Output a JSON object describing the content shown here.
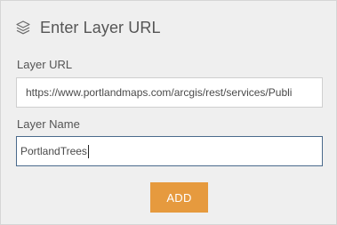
{
  "header": {
    "icon": "layers-icon",
    "title": "Enter Layer URL"
  },
  "url_field": {
    "label": "Layer URL",
    "value": "https://www.portlandmaps.com/arcgis/rest/services/Publi"
  },
  "name_field": {
    "label": "Layer Name",
    "value": "PortlandTrees"
  },
  "add_button": {
    "label": "ADD"
  },
  "colors": {
    "accent": "#e69a3e",
    "panel_bg": "#efefef",
    "focus_border": "#4a6a8c"
  }
}
